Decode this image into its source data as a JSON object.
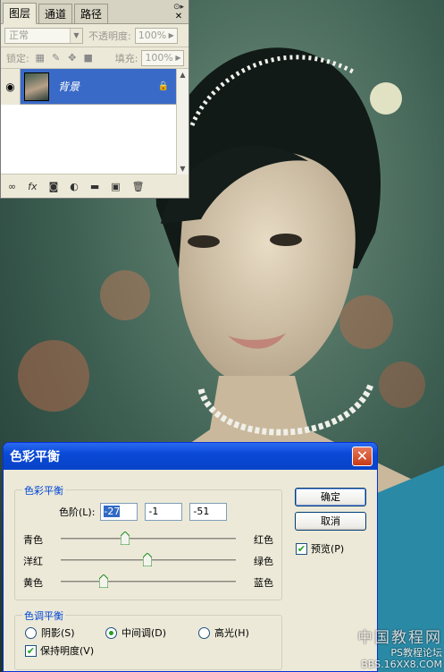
{
  "layers_panel": {
    "tabs": [
      "图层",
      "通道",
      "路径"
    ],
    "blend_mode": "正常",
    "opacity_label": "不透明度:",
    "opacity_value": "100%",
    "lock_label": "锁定:",
    "fill_label": "填充:",
    "fill_value": "100%",
    "layer": {
      "name": "背景"
    },
    "footer_icons": [
      "link-icon",
      "fx-icon",
      "mask-icon",
      "adjustment-icon",
      "folder-icon",
      "new-layer-icon",
      "trash-icon"
    ]
  },
  "dialog": {
    "title": "色彩平衡",
    "color_balance_group": "色彩平衡",
    "levels_label": "色阶(L):",
    "levels": [
      "-27",
      "-1",
      "-51"
    ],
    "sliders": [
      {
        "left": "青色",
        "right": "红色",
        "value": -27
      },
      {
        "left": "洋红",
        "right": "绿色",
        "value": -1
      },
      {
        "left": "黄色",
        "right": "蓝色",
        "value": -51
      }
    ],
    "tone_group": "色调平衡",
    "tones": [
      "阴影(S)",
      "中间调(D)",
      "高光(H)"
    ],
    "selected_tone": "中间调(D)",
    "preserve_luminosity": "保持明度(V)",
    "ok": "确定",
    "cancel": "取消",
    "preview": "预览(P)"
  },
  "watermark": {
    "line1": "中国教程网",
    "line2": "PS教程论坛",
    "line3": "BBS.16XX8.COM"
  }
}
